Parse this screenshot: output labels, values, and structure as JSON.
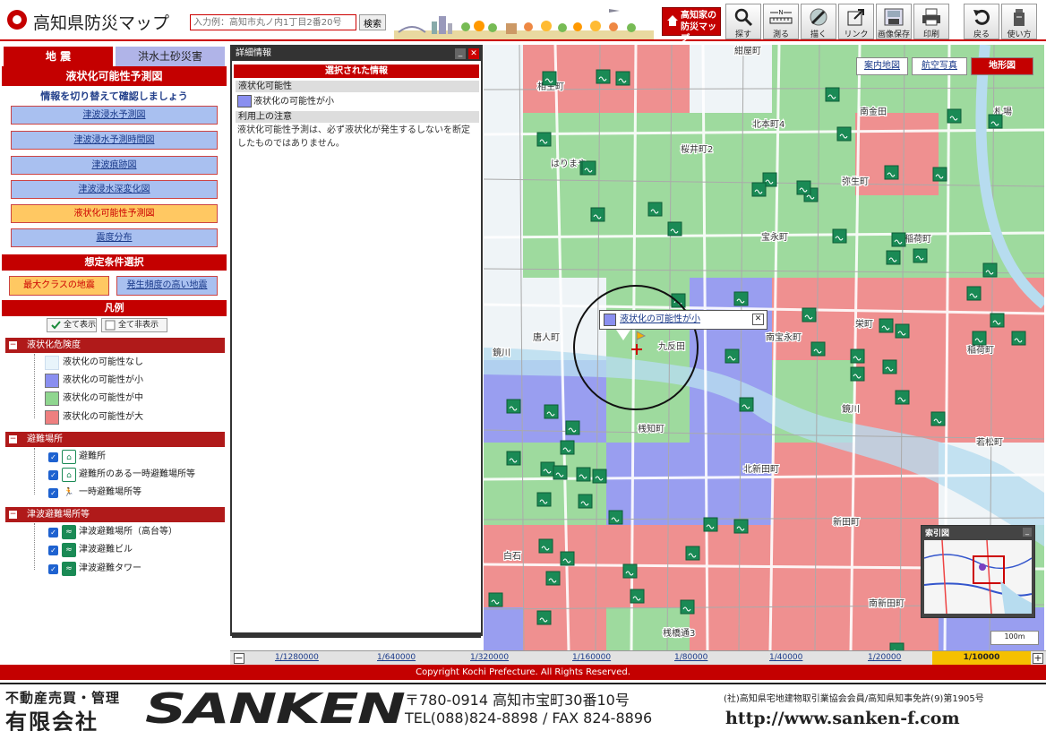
{
  "header": {
    "title": "高知県防災マップ",
    "search_placeholder": "入力例：高知市丸ノ内1丁目2番20号",
    "search_label": "検索",
    "kochi_map_label": "高知家の 防災マップ",
    "tools": [
      {
        "label": "探す",
        "icon": "search-icon"
      },
      {
        "label": "測る",
        "icon": "measure-icon"
      },
      {
        "label": "描く",
        "icon": "draw-icon"
      },
      {
        "label": "リンク",
        "icon": "link-icon"
      },
      {
        "label": "画像保存",
        "icon": "save-image-icon"
      },
      {
        "label": "印刷",
        "icon": "print-icon"
      },
      {
        "label": "戻る",
        "icon": "back-icon"
      },
      {
        "label": "使い方",
        "icon": "help-icon"
      }
    ]
  },
  "left_panel": {
    "tabs": [
      "地 震",
      "洪水土砂災害"
    ],
    "title": "液状化可能性予測図",
    "subtitle": "情報を切り替えて確認しましょう",
    "map_buttons": [
      {
        "label": "津波浸水予測図",
        "active": false
      },
      {
        "label": "津波浸水予測時間図",
        "active": false
      },
      {
        "label": "津波痕跡図",
        "active": false
      },
      {
        "label": "津波浸水深変化図",
        "active": false
      },
      {
        "label": "液状化可能性予測図",
        "active": true
      },
      {
        "label": "震度分布",
        "active": false
      }
    ],
    "condition_title": "想定条件選択",
    "conditions": [
      "最大クラスの地震",
      "発生頻度の高い地震"
    ],
    "legend_title": "凡例",
    "show_all": "全て表示",
    "hide_all": "全て非表示",
    "groups": [
      {
        "label": "液状化危険度",
        "items": [
          {
            "label": "液状化の可能性なし",
            "color": "#e8f4fb"
          },
          {
            "label": "液状化の可能性が小",
            "color": "#8a8ff0"
          },
          {
            "label": "液状化の可能性が中",
            "color": "#8fd68f"
          },
          {
            "label": "液状化の可能性が大",
            "color": "#ee7f7f"
          }
        ]
      },
      {
        "label": "避難場所",
        "items": [
          {
            "label": "避難所",
            "icon": "shelter-icon"
          },
          {
            "label": "避難所のある一時避難場所等",
            "icon": "shelter-temporary-icon"
          },
          {
            "label": "一時避難場所等",
            "icon": "evacuation-run-icon"
          }
        ]
      },
      {
        "label": "津波避難場所等",
        "items": [
          {
            "label": "津波避難場所（高台等）",
            "icon": "tsunami-high-ground-icon"
          },
          {
            "label": "津波避難ビル",
            "icon": "tsunami-building-icon"
          },
          {
            "label": "津波避難タワー",
            "icon": "tsunami-tower-icon"
          }
        ]
      }
    ]
  },
  "detail_panel": {
    "header": "詳細情報",
    "selected_title": "選択された情報",
    "value_label": "液状化可能性",
    "value": "液状化の可能性が小",
    "note_label": "利用上の注意",
    "note": "液状化可能性予測は、必ず液状化が発生するしないを断定したものではありません。"
  },
  "map": {
    "tabs": [
      "案内地図",
      "航空写真",
      "地形図"
    ],
    "active_tab": "地形図",
    "popup_text": "液状化の可能性が小",
    "index_title": "索引図",
    "scale_ruler": "100m",
    "labels": [
      {
        "text": "相生町"
      },
      {
        "text": "北本町4"
      },
      {
        "text": "南金田"
      },
      {
        "text": "札場"
      },
      {
        "text": "はりまや"
      },
      {
        "text": "桜井町2"
      },
      {
        "text": "弥生町"
      },
      {
        "text": "宝永町"
      },
      {
        "text": "稲荷町"
      },
      {
        "text": "唐人町"
      },
      {
        "text": "九反田"
      },
      {
        "text": "南宝永町"
      },
      {
        "text": "栄町"
      },
      {
        "text": "稲荷町"
      },
      {
        "text": "桟知町"
      },
      {
        "text": "北新田町"
      },
      {
        "text": "若松町"
      },
      {
        "text": "新田町"
      },
      {
        "text": "白石"
      },
      {
        "text": "南新田町"
      },
      {
        "text": "桟橋通3"
      },
      {
        "text": "鏡川"
      },
      {
        "text": "紺屋町"
      },
      {
        "text": "鏡川"
      }
    ]
  },
  "scale_bar": {
    "items": [
      "1/1280000",
      "1/640000",
      "1/320000",
      "1/160000",
      "1/80000",
      "1/40000",
      "1/20000",
      "1/10000"
    ],
    "active": "1/10000"
  },
  "copyright": "Copyright Kochi Prefecture. All Rights Reserved.",
  "footer": {
    "company_small": "不動産売買・管理",
    "company_big": "有限会社",
    "logo": "SANKEN",
    "postal": "〒780-0914 高知市宝町30番10号",
    "tel": "TEL(088)824-8898 / FAX 824-8896",
    "license": "(社)高知県宅地建物取引業協会会員/高知県知事免許(9)第1905号",
    "url": "http://www.sanken-f.com"
  }
}
